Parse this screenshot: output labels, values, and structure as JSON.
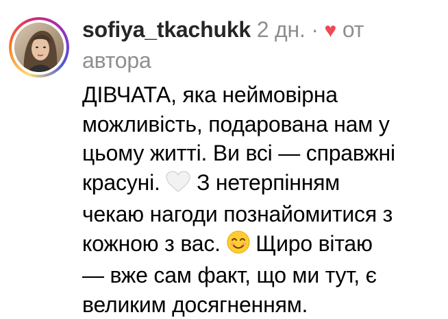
{
  "comment": {
    "username": "sofiya_tkachukk",
    "time": "2 дн.",
    "separator": "·",
    "liked_by_author_label": "от",
    "liked_by_author_label_2": "автора",
    "lines": [
      "ДІВЧАТА, яка неймовірна",
      "можливість, подарована нам у",
      "цьому житті. Ви всі — справжні",
      "красуні.",
      "З нетерпінням",
      "чекаю нагоди познайомитися з",
      "кожною з вас.",
      "Щиро вітаю",
      "— вже сам факт, що ми тут, є",
      "великим досягненням."
    ],
    "emojis": {
      "heart_emoji": "white-heart-icon",
      "smile_emoji": "smiling-face-icon",
      "like_icon": "red-heart-icon"
    },
    "colors": {
      "meta_gray": "#8e8e8e",
      "like_red": "#ed4956",
      "text": "#000000"
    }
  }
}
